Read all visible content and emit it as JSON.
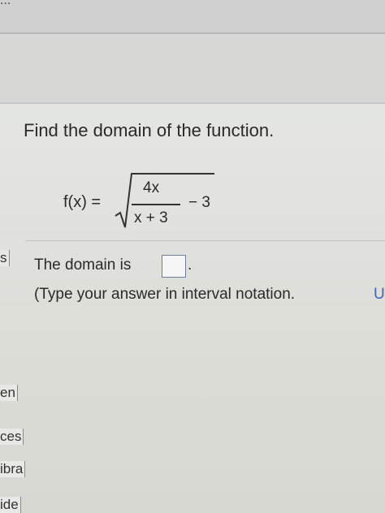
{
  "top_cut_text": "...",
  "left_tabs": [
    "s",
    "en",
    "ces",
    "ibra",
    "ide"
  ],
  "question": "Find the domain of the function.",
  "formula": {
    "lhs": "f(x) =",
    "numerator": "4x",
    "denominator": "x + 3",
    "tail": "− 3"
  },
  "answer": {
    "prefix": "The domain is",
    "suffix": "."
  },
  "hint": "(Type your answer in interval notation.",
  "hint_cut": "U"
}
